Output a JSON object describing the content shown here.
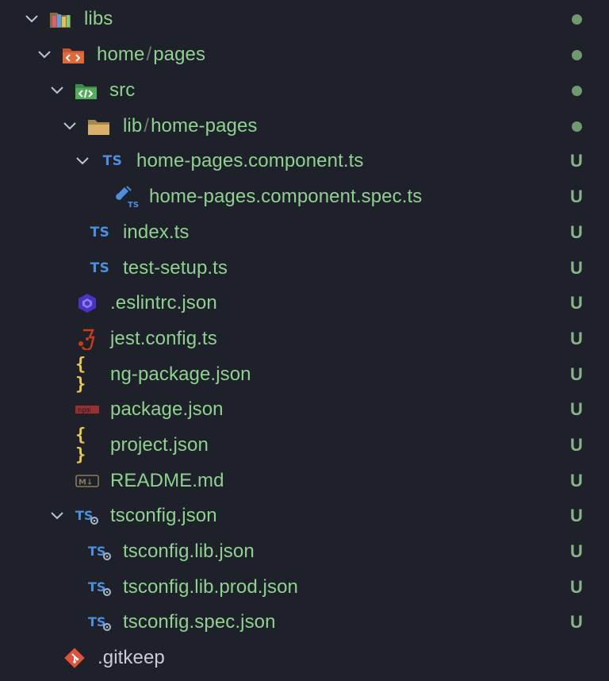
{
  "explorer": {
    "items": [
      {
        "label": "libs",
        "icon": "folder-libs-icon",
        "status": "modified-dot",
        "expanded": true
      },
      {
        "label_a": "home",
        "label_sep": "/",
        "label_b": "pages",
        "icon": "folder-html-icon",
        "status": "modified-dot",
        "expanded": true
      },
      {
        "label": "src",
        "icon": "folder-src-icon",
        "status": "modified-dot",
        "expanded": true
      },
      {
        "label_a": "lib",
        "label_sep": "/",
        "label_b": "home-pages",
        "icon": "folder-icon",
        "status": "modified-dot",
        "expanded": true
      },
      {
        "label": "home-pages.component.ts",
        "icon": "typescript-icon",
        "status": "U",
        "expanded": true
      },
      {
        "label": "home-pages.component.spec.ts",
        "icon": "typescript-test-icon",
        "status": "U"
      },
      {
        "label": "index.ts",
        "icon": "typescript-icon",
        "status": "U"
      },
      {
        "label": "test-setup.ts",
        "icon": "typescript-icon",
        "status": "U"
      },
      {
        "label": ".eslintrc.json",
        "icon": "eslint-icon",
        "status": "U"
      },
      {
        "label": "jest.config.ts",
        "icon": "jest-icon",
        "status": "U"
      },
      {
        "label": "ng-package.json",
        "icon": "json-icon",
        "status": "U"
      },
      {
        "label": "package.json",
        "icon": "npm-icon",
        "status": "U"
      },
      {
        "label": "project.json",
        "icon": "json-icon",
        "status": "U"
      },
      {
        "label": "README.md",
        "icon": "markdown-icon",
        "status": "U"
      },
      {
        "label": "tsconfig.json",
        "icon": "tsconfig-icon",
        "status": "U",
        "expanded": true
      },
      {
        "label": "tsconfig.lib.json",
        "icon": "tsconfig-icon",
        "status": "U"
      },
      {
        "label": "tsconfig.lib.prod.json",
        "icon": "tsconfig-icon",
        "status": "U"
      },
      {
        "label": "tsconfig.spec.json",
        "icon": "tsconfig-icon",
        "status": "U"
      },
      {
        "label": ".gitkeep",
        "icon": "git-icon",
        "status": ""
      }
    ],
    "icon_text": {
      "ts": "TS",
      "braces": "{ }",
      "npm": "npm",
      "md": "M↓"
    }
  },
  "colors": {
    "background": "#1e202a",
    "untracked_text": "#8fd18f",
    "plain_text": "#c9ccd4",
    "badge": "#86b686",
    "dot": "#6f9a6f",
    "typescript": "#4d8fdc"
  }
}
